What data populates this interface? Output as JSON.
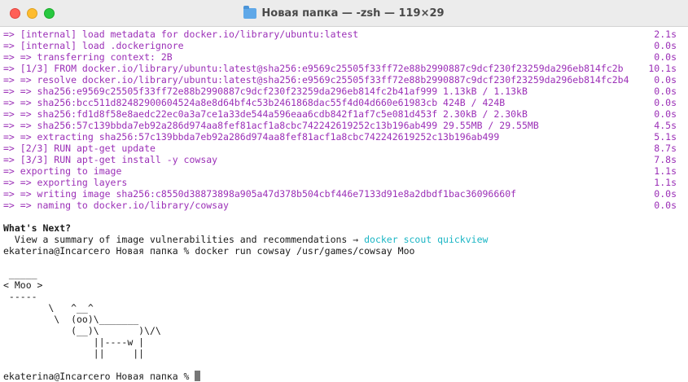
{
  "window": {
    "title": "Новая папка — -zsh — 119×29",
    "folder_icon": "folder-icon"
  },
  "build": [
    {
      "text": "=> [internal] load metadata for docker.io/library/ubuntu:latest",
      "time": "2.1s"
    },
    {
      "text": "=> [internal] load .dockerignore",
      "time": "0.0s"
    },
    {
      "text": "=> => transferring context: 2B",
      "time": "0.0s"
    },
    {
      "text": "=> [1/3] FROM docker.io/library/ubuntu:latest@sha256:e9569c25505f33ff72e88b2990887c9dcf230f23259da296eb814fc2b",
      "time": "10.1s"
    },
    {
      "text": "=> => resolve docker.io/library/ubuntu:latest@sha256:e9569c25505f33ff72e88b2990887c9dcf230f23259da296eb814fc2b4",
      "time": "0.0s"
    },
    {
      "text": "=> => sha256:e9569c25505f33ff72e88b2990887c9dcf230f23259da296eb814fc2b41af999 1.13kB / 1.13kB",
      "time": "0.0s"
    },
    {
      "text": "=> => sha256:bcc511d82482900604524a8e8d64bf4c53b2461868dac55f4d04d660e61983cb 424B / 424B",
      "time": "0.0s"
    },
    {
      "text": "=> => sha256:fd1d8f58e8aedc22ec0a3a7ce1a33de544a596eaa6cdb842f1af7c5e081d453f 2.30kB / 2.30kB",
      "time": "0.0s"
    },
    {
      "text": "=> => sha256:57c139bbda7eb92a286d974aa8fef81acf1a8cbc742242619252c13b196ab499 29.55MB / 29.55MB",
      "time": "4.5s"
    },
    {
      "text": "=> => extracting sha256:57c139bbda7eb92a286d974aa8fef81acf1a8cbc742242619252c13b196ab499",
      "time": "5.1s"
    },
    {
      "text": "=> [2/3] RUN apt-get update",
      "time": "8.7s"
    },
    {
      "text": "=> [3/3] RUN apt-get install -y cowsay",
      "time": "7.8s"
    },
    {
      "text": "=> exporting to image",
      "time": "1.1s"
    },
    {
      "text": "=> => exporting layers",
      "time": "1.1s"
    },
    {
      "text": "=> => writing image sha256:c8550d38873898a905a47d378b504cbf446e7133d91e8a2dbdf1bac36096660f",
      "time": "0.0s"
    },
    {
      "text": "=> => naming to docker.io/library/cowsay",
      "time": "0.0s"
    }
  ],
  "whats_next": {
    "heading": "What's Next?",
    "text": "  View a summary of image vulnerabilities and recommendations → ",
    "command": "docker scout quickview"
  },
  "prompt_command": "ekaterina@Incarcero Новая папка % docker run cowsay /usr/games/cowsay Moo",
  "cowsay": [
    " _____",
    "< Moo >",
    " -----",
    "        \\   ^__^",
    "         \\  (oo)\\_______",
    "            (__)\\       )\\/\\",
    "                ||----w |",
    "                ||     ||"
  ],
  "final_prompt": "ekaterina@Incarcero Новая папка % ",
  "colors": {
    "build_text": "#9b2fb7",
    "link": "#1ab5c4"
  }
}
